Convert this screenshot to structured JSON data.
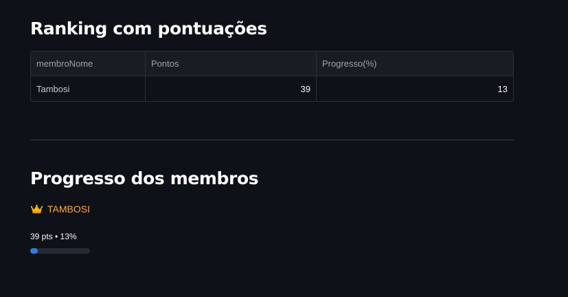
{
  "ranking": {
    "title": "Ranking com pontuações",
    "columns": [
      "membroNome",
      "Pontos",
      "Progresso(%)"
    ],
    "rows": [
      [
        "Tambosi",
        "39",
        "13"
      ]
    ]
  },
  "progress_section": {
    "title": "Progresso dos membros",
    "members": [
      {
        "icon": "crown-icon",
        "name": "TAMBOSI",
        "stats": "39 pts • 13%",
        "progress_percent": 13
      }
    ]
  },
  "colors": {
    "background": "#0e1117",
    "member_name": "#ffa94d",
    "progress_fill": "#2f7de1",
    "progress_track": "#262a33"
  }
}
